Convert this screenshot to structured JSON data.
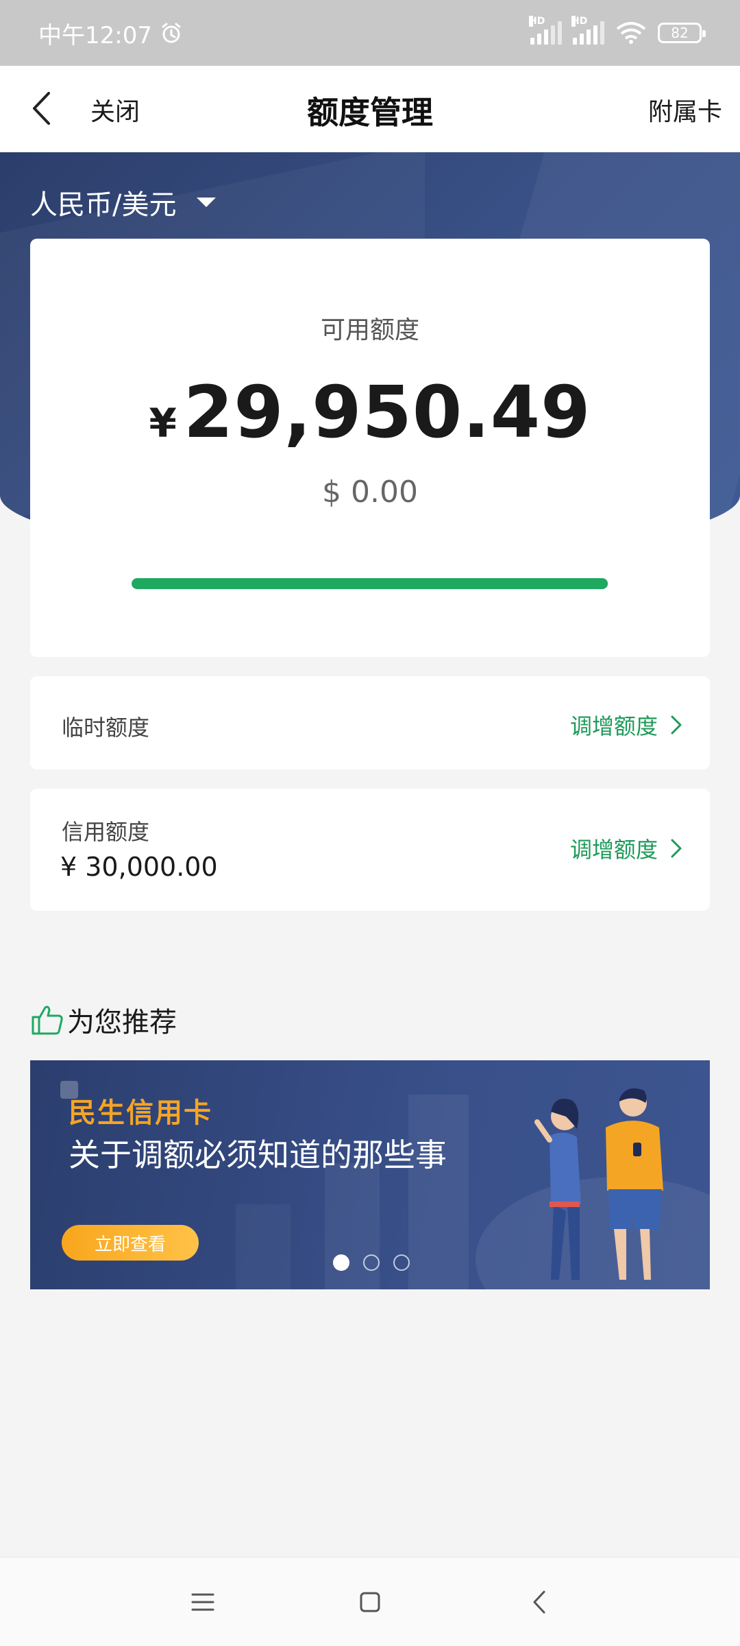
{
  "status_bar": {
    "time": "中午12:07",
    "battery": "82",
    "signal_label": "HD"
  },
  "header": {
    "close_label": "关闭",
    "title": "额度管理",
    "right_label": "附属卡"
  },
  "currency_selector": {
    "value": "人民币/美元"
  },
  "available": {
    "label": "可用额度",
    "currency_symbol": "¥",
    "amount": "29,950.49",
    "usd_amount": "$ 0.00",
    "progress_fraction": 0.998
  },
  "temp_limit": {
    "label": "临时额度",
    "action": "调增额度"
  },
  "credit_limit": {
    "label": "信用额度",
    "value": "¥ 30,000.00",
    "action": "调增额度"
  },
  "recommend": {
    "title": "为您推荐"
  },
  "banner": {
    "brand": "民生信用卡",
    "headline": "关于调额必须知道的那些事",
    "button": "立即查看",
    "slide_count": 3,
    "active_slide": 1
  },
  "colors": {
    "accent_green": "#1fa860",
    "hero_blue": "#34497c",
    "banner_orange": "#f5a524"
  }
}
